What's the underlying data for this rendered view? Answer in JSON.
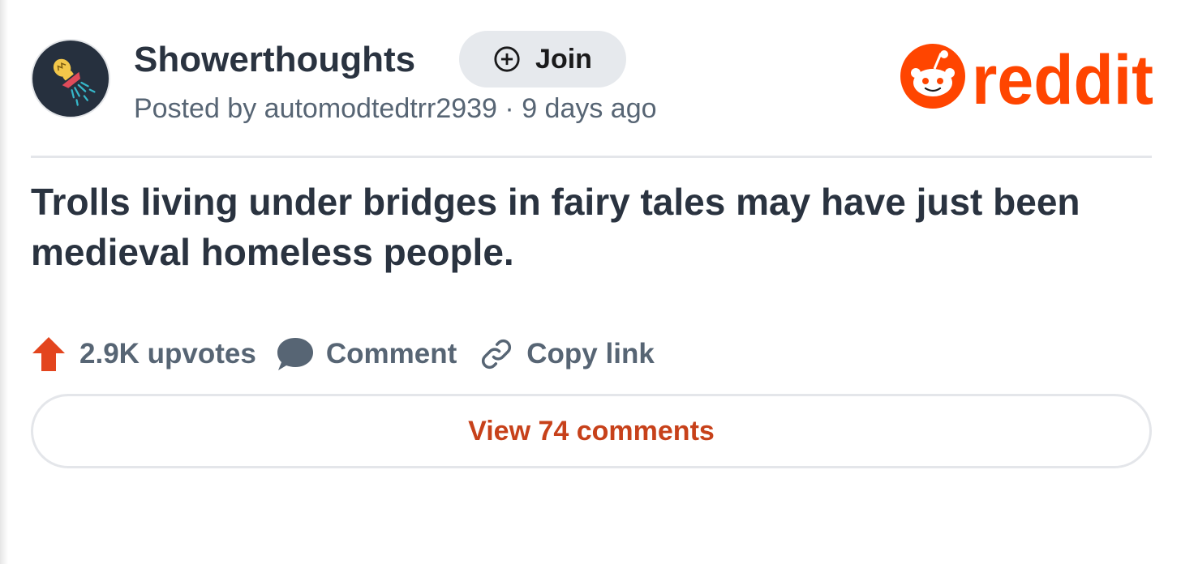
{
  "subreddit": {
    "name": "Showerthoughts",
    "avatar_icon": "lightbulb-shower-icon",
    "join_label": "Join",
    "join_icon": "plus-circle-icon"
  },
  "post": {
    "posted_by_prefix": "Posted by ",
    "author": "automodtedtrr2939",
    "separator": " · ",
    "age": "9 days ago",
    "title": "Trolls living under bridges in fairy tales may have just been medieval homeless people."
  },
  "brand": {
    "wordmark": "reddit",
    "logo_icon": "reddit-snoo-icon"
  },
  "actions": {
    "upvotes_label": "2.9K upvotes",
    "upvote_icon": "upvote-arrow-icon",
    "comment_label": "Comment",
    "comment_icon": "comment-bubble-icon",
    "copy_link_label": "Copy link",
    "copy_link_icon": "link-icon"
  },
  "view_comments_label": "View 74 comments",
  "colors": {
    "brand_orange": "#ff4500",
    "upvote_orange": "#e3451e",
    "link_orange": "#c7411a",
    "title_text": "#2a3340",
    "muted_text": "#576574",
    "avatar_bg": "#26303e",
    "join_bg": "#e6e9ed"
  }
}
